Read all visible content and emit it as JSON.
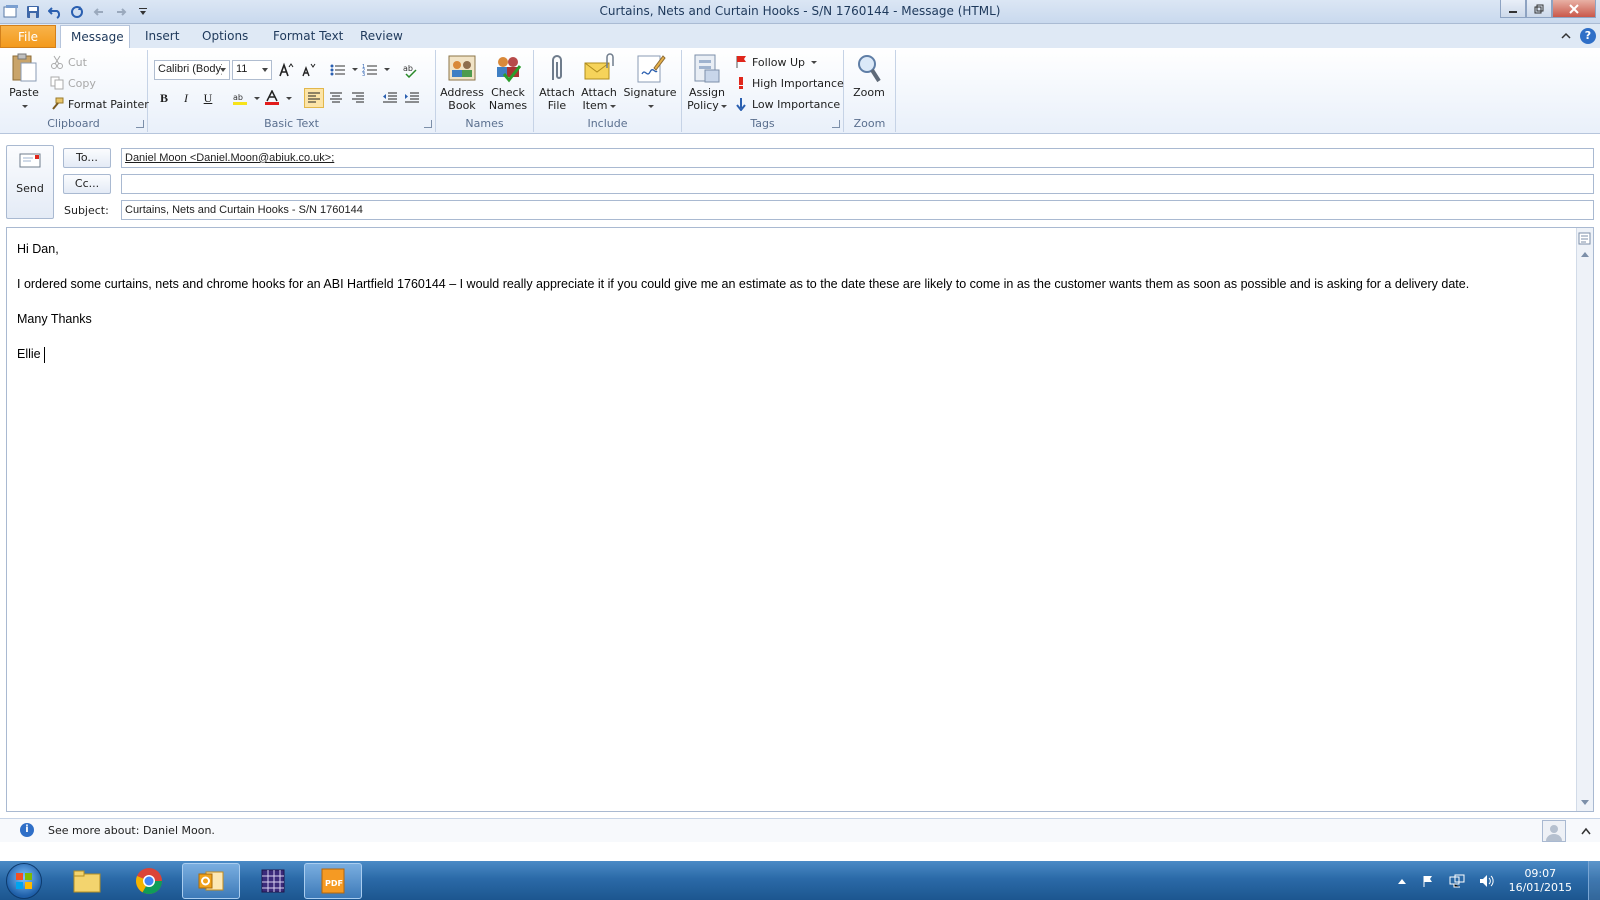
{
  "window": {
    "title": "Curtains, Nets and Curtain Hooks - S/N 1760144  -  Message (HTML)"
  },
  "tabs": [
    {
      "label": "File"
    },
    {
      "label": "Message"
    },
    {
      "label": "Insert"
    },
    {
      "label": "Options"
    },
    {
      "label": "Format Text"
    },
    {
      "label": "Review"
    }
  ],
  "ribbon": {
    "clipboard": {
      "label": "Clipboard",
      "paste": "Paste",
      "cut": "Cut",
      "copy": "Copy",
      "format_painter": "Format Painter"
    },
    "basic_text": {
      "label": "Basic Text",
      "font": "Calibri (Body)",
      "font_size": "11"
    },
    "names": {
      "label": "Names",
      "address_book_1": "Address",
      "address_book_2": "Book",
      "check_names_1": "Check",
      "check_names_2": "Names"
    },
    "include": {
      "label": "Include",
      "attach_file_1": "Attach",
      "attach_file_2": "File",
      "attach_item_1": "Attach",
      "attach_item_2": "Item",
      "signature": "Signature"
    },
    "tags": {
      "label": "Tags",
      "assign_policy_1": "Assign",
      "assign_policy_2": "Policy",
      "follow_up": "Follow Up",
      "high_importance": "High Importance",
      "low_importance": "Low Importance"
    },
    "zoom": {
      "label": "Zoom",
      "zoom": "Zoom"
    }
  },
  "header": {
    "send": "Send",
    "to_button": "To...",
    "cc_button": "Cc...",
    "subject_label": "Subject:",
    "to_value": "Daniel Moon <Daniel.Moon@abiuk.co.uk>;",
    "cc_value": "",
    "subject_value": "Curtains, Nets and Curtain Hooks - S/N 1760144"
  },
  "body": {
    "greeting": "Hi Dan,",
    "paragraph": "I ordered some curtains, nets and chrome hooks for an ABI Hartfield 1760144 – I would really appreciate it if you could give me an estimate as to the date these are likely to come in as the customer wants them as soon as possible and is asking for a delivery date.",
    "closing": "Many Thanks",
    "signature": "Ellie"
  },
  "people_pane": {
    "text": "See more about: Daniel Moon."
  },
  "taskbar": {
    "time": "09:07",
    "date": "16/01/2015"
  },
  "colors": {
    "file_tab": "#f39a1c",
    "ribbon_bg": "#e9f0fa",
    "taskbar": "#2b6aa8",
    "accent": "#2f6fc7"
  }
}
